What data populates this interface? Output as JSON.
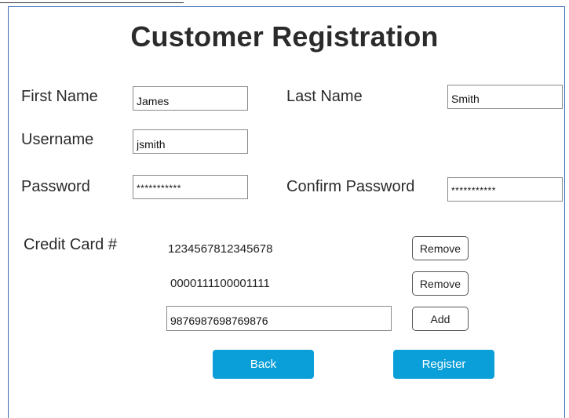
{
  "page": {
    "title": "Customer Registration"
  },
  "form": {
    "first_name": {
      "label": "First Name",
      "value": "James"
    },
    "last_name": {
      "label": "Last Name",
      "value": "Smith"
    },
    "username": {
      "label": "Username",
      "value": "jsmith"
    },
    "password": {
      "label": "Password",
      "value": "***********"
    },
    "confirm_password": {
      "label": "Confirm Password",
      "value": "***********"
    }
  },
  "credit_cards": {
    "label": "Credit Card #",
    "items": [
      {
        "number": "1234567812345678",
        "action": "Remove"
      },
      {
        "number": "0000111100001111",
        "action": "Remove"
      }
    ],
    "new_card": {
      "value": "9876987698769876",
      "action": "Add"
    }
  },
  "actions": {
    "back": "Back",
    "register": "Register"
  },
  "colors": {
    "primary_button": "#0a9fd8",
    "panel_border": "#3a6db5"
  }
}
